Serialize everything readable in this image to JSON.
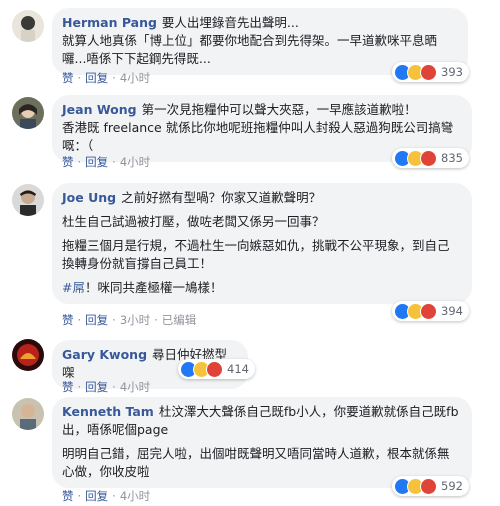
{
  "comments": [
    {
      "author": "Herman Pang",
      "paragraphs": [
        "要人出埋錄音先出聲明...",
        "就算人地真係「博上位」都要你地配合到先得架。一早道歉咪平息晒囉...唔係下下起鋼先得既..."
      ],
      "meta": {
        "like": "赞",
        "reply": "回复",
        "time": "4小时"
      },
      "reactions": {
        "icons": [
          "like-icon",
          "haha-icon",
          "angry-icon"
        ],
        "count": "393"
      }
    },
    {
      "author": "Jean Wong",
      "paragraphs": [
        "第一次見拖糧仲可以聲大夾惡，一早應該道歉啦！",
        "香港既 freelance 就係比你地呢班拖糧仲叫人封殺人惡過狗既公司搞彎嘅：（"
      ],
      "meta": {
        "like": "赞",
        "reply": "回复",
        "time": "4小时"
      },
      "reactions": {
        "icons": [
          "like-icon",
          "haha-icon",
          "angry-icon"
        ],
        "count": "835"
      }
    },
    {
      "author": "Joe Ung",
      "paragraphs": [
        "之前好撚有型喎？你家又道歉聲明？",
        "杜生自己試過被打壓，做咗老闆又係另一回事？",
        "拖糧三個月是行規，不過杜生一向嫉惡如仇，挑戰不公平現象，到自己換轉身份就盲撐自己員工！"
      ],
      "hashtag_line": {
        "tag": "#屌",
        "text": "！咪同共產極權一鳩樣！"
      },
      "meta": {
        "like": "赞",
        "reply": "回复",
        "time": "3小时",
        "edited": "已编辑"
      },
      "reactions": {
        "icons": [
          "like-icon",
          "haha-icon",
          "angry-icon"
        ],
        "count": "394"
      }
    },
    {
      "author": "Gary Kwong",
      "paragraphs": [
        "尋日仲好撚型㗎"
      ],
      "meta": {
        "like": "赞",
        "reply": "回复",
        "time": "4小时"
      },
      "reactions": {
        "icons": [
          "like-icon",
          "haha-icon",
          "angry-icon"
        ],
        "count": "414"
      }
    },
    {
      "author": "Kenneth Tam",
      "paragraphs": [
        "杜汶澤大大聲係自己既fb小人，你要道歉就係自己既fb出，唔係呢個page",
        "明明自己錯，屈完人啦，出個咁既聲明又唔同當時人道歉，根本就係無心做，你收皮啦"
      ],
      "meta": {
        "like": "赞",
        "reply": "回复",
        "time": "4小时"
      },
      "reactions": {
        "icons": [
          "like-icon",
          "haha-icon",
          "angry-icon"
        ],
        "count": "592"
      }
    }
  ],
  "colors": {
    "bubble": "#f2f3f5",
    "name": "#385898",
    "meta": "#90949c",
    "like": "#2078f4",
    "haha": "#f7c23b",
    "angry": "#e04438"
  }
}
